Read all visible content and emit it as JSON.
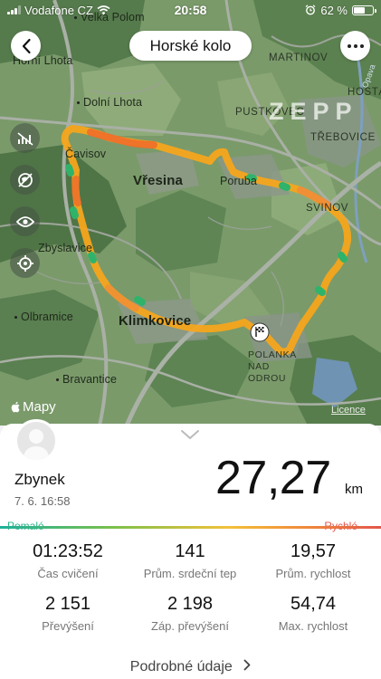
{
  "status_bar": {
    "carrier": "Vodafone CZ",
    "time": "20:58",
    "battery": "62 %",
    "battery_level": 0.62
  },
  "header": {
    "back_icon": "chevron-left-icon",
    "title": "Horské kolo",
    "more_icon": "ellipsis-icon"
  },
  "map": {
    "watermark": "ZEPP",
    "attribution": "Mapy",
    "licence": "Licence",
    "places": [
      {
        "name": "Velká Polom"
      },
      {
        "name": "Horní Lhota"
      },
      {
        "name": "MARTINOV"
      },
      {
        "name": "Dolní Lhota"
      },
      {
        "name": "PUSTKOVEC"
      },
      {
        "name": "HOŠŤÁLKOVICE"
      },
      {
        "name": "TŘEBOVICE"
      },
      {
        "name": "Čavisov"
      },
      {
        "name": "Vřesina"
      },
      {
        "name": "Poruba"
      },
      {
        "name": "SVINOV"
      },
      {
        "name": "Zbyslavice"
      },
      {
        "name": "Olbramice"
      },
      {
        "name": "Klimkovice"
      },
      {
        "name": "POLANKA NAD ODROU"
      },
      {
        "name": "Bravantice"
      },
      {
        "name": "Opava"
      }
    ],
    "tools": [
      "speed-off-icon",
      "layer-off-icon",
      "eye-icon",
      "locate-icon"
    ]
  },
  "summary": {
    "user_name": "Zbynek",
    "date": "7. 6. 16:58",
    "distance": "27,27",
    "distance_unit": "km",
    "speed_slow_label": "Pomalé",
    "speed_fast_label": "Rychlé",
    "stats": [
      {
        "value": "01:23:52",
        "label": "Čas cvičení"
      },
      {
        "value": "141",
        "label": "Prům. srdeční tep"
      },
      {
        "value": "19,57",
        "label": "Prům. rychlost"
      },
      {
        "value": "2 151",
        "label": "Převýšení"
      },
      {
        "value": "2 198",
        "label": "Záp. převýšení"
      },
      {
        "value": "54,74",
        "label": "Max. rychlost"
      }
    ],
    "details_label": "Podrobné údaje"
  },
  "colors": {
    "route_main": "#f6a51c",
    "route_fast": "#ee6a2a",
    "route_slow": "#2fb36b",
    "slow": "#2bb38d",
    "fast": "#e2574c"
  }
}
